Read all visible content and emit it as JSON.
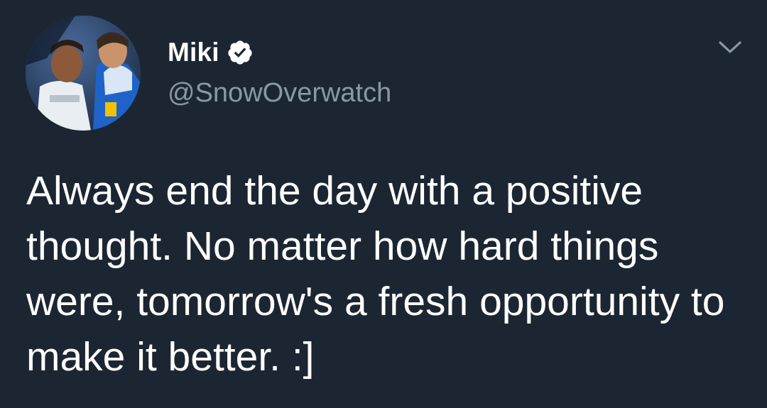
{
  "tweet": {
    "author": {
      "display_name": "Miki",
      "handle": "@SnowOverwatch",
      "verified": true,
      "avatar_icon": "profile-photo"
    },
    "menu_icon": "chevron-down-icon",
    "text": "Always end the day with a positive thought. No matter how hard things were, tomorrow's a fresh opportunity to make it better. :]"
  },
  "colors": {
    "background": "#1c2633",
    "text": "#ffffff",
    "secondary_text": "#8899a6",
    "verified_badge": "#ffffff"
  }
}
